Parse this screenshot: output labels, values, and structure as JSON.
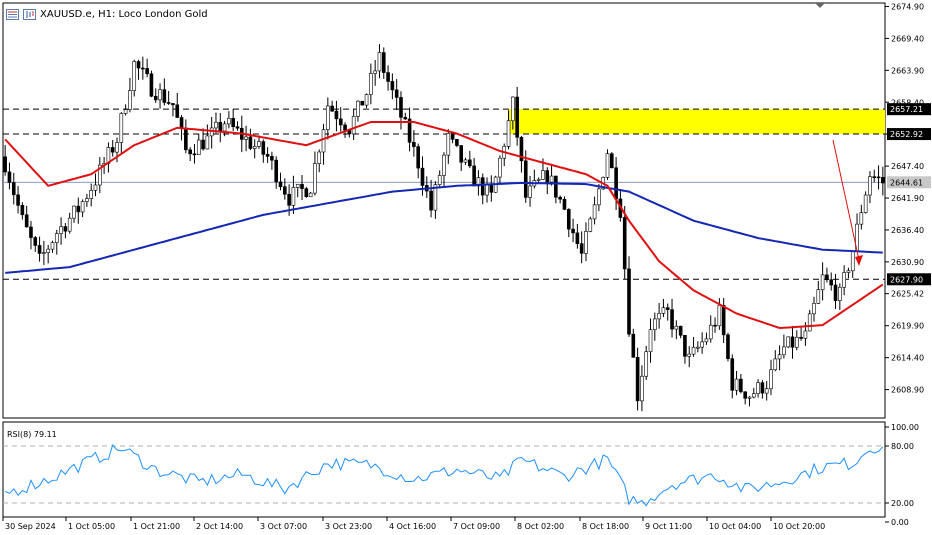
{
  "header": {
    "title": "XAUUSD.e, H1:  Loco London Gold"
  },
  "colors": {
    "background": "#ffffff",
    "candle": "#000000",
    "ma_fast": "#e01010",
    "ma_slow": "#1428b4",
    "zone": "#ffff00",
    "arrow": "#e01010",
    "rsi": "#1e90ff",
    "grid_dashed": "#000000"
  },
  "price_axis": {
    "ticks": [
      "2674.90",
      "2669.40",
      "2663.90",
      "2658.40",
      "2652.92",
      "2647.40",
      "2641.90",
      "2636.40",
      "2630.90",
      "2625.42",
      "2619.90",
      "2614.40",
      "2608.90"
    ],
    "tick_values": [
      2674.9,
      2669.4,
      2663.9,
      2658.4,
      2652.92,
      2647.4,
      2641.9,
      2636.4,
      2630.9,
      2625.42,
      2619.9,
      2614.4,
      2608.9
    ]
  },
  "price_labels": {
    "resistance_upper": "2657.21",
    "resistance_lower": "2652.92",
    "current": "2644.61",
    "support": "2627.90"
  },
  "time_axis": {
    "labels": [
      "30 Sep 2024",
      "1 Oct 05:00",
      "1 Oct 21:00",
      "2 Oct 14:00",
      "3 Oct 07:00",
      "3 Oct 23:00",
      "4 Oct 16:00",
      "7 Oct 09:00",
      "8 Oct 02:00",
      "8 Oct 18:00",
      "9 Oct 11:00",
      "10 Oct 04:00",
      "10 Oct 20:00"
    ]
  },
  "rsi": {
    "label": "RSI(8) 79.11",
    "ticks": [
      "100.00",
      "80.00",
      "20.00",
      "0.00"
    ],
    "tick_values": [
      100,
      80,
      20,
      0
    ]
  },
  "chart_data": {
    "type": "candlestick",
    "title": "XAUUSD.e, H1:  Loco London Gold",
    "ylim": [
      2604.0,
      2675.5
    ],
    "horizontal_levels": [
      2657.21,
      2652.92,
      2644.61,
      2627.9
    ],
    "zone": [
      2652.92,
      2657.21
    ],
    "anchors": [
      {
        "i": 0,
        "c": 2648
      },
      {
        "i": 4,
        "c": 2638
      },
      {
        "i": 8,
        "c": 2631
      },
      {
        "i": 12,
        "c": 2636
      },
      {
        "i": 17,
        "c": 2640
      },
      {
        "i": 21,
        "c": 2645
      },
      {
        "i": 26,
        "c": 2652
      },
      {
        "i": 30,
        "c": 2665
      },
      {
        "i": 34,
        "c": 2661
      },
      {
        "i": 39,
        "c": 2658
      },
      {
        "i": 42,
        "c": 2650
      },
      {
        "i": 47,
        "c": 2652
      },
      {
        "i": 51,
        "c": 2655
      },
      {
        "i": 56,
        "c": 2652
      },
      {
        "i": 61,
        "c": 2649
      },
      {
        "i": 66,
        "c": 2642
      },
      {
        "i": 71,
        "c": 2644
      },
      {
        "i": 75,
        "c": 2658
      },
      {
        "i": 80,
        "c": 2654
      },
      {
        "i": 84,
        "c": 2660
      },
      {
        "i": 87,
        "c": 2666
      },
      {
        "i": 92,
        "c": 2656
      },
      {
        "i": 96,
        "c": 2648
      },
      {
        "i": 99,
        "c": 2640
      },
      {
        "i": 103,
        "c": 2652
      },
      {
        "i": 108,
        "c": 2646
      },
      {
        "i": 113,
        "c": 2642
      },
      {
        "i": 118,
        "c": 2658
      },
      {
        "i": 121,
        "c": 2642
      },
      {
        "i": 126,
        "c": 2646
      },
      {
        "i": 130,
        "c": 2640
      },
      {
        "i": 134,
        "c": 2632
      },
      {
        "i": 137,
        "c": 2640
      },
      {
        "i": 140,
        "c": 2650
      },
      {
        "i": 143,
        "c": 2640
      },
      {
        "i": 145,
        "c": 2620
      },
      {
        "i": 147,
        "c": 2608
      },
      {
        "i": 150,
        "c": 2620
      },
      {
        "i": 154,
        "c": 2622
      },
      {
        "i": 159,
        "c": 2614
      },
      {
        "i": 163,
        "c": 2618
      },
      {
        "i": 166,
        "c": 2622
      },
      {
        "i": 169,
        "c": 2610
      },
      {
        "i": 173,
        "c": 2608
      },
      {
        "i": 177,
        "c": 2610
      },
      {
        "i": 181,
        "c": 2616
      },
      {
        "i": 186,
        "c": 2618
      },
      {
        "i": 190,
        "c": 2628
      },
      {
        "i": 194,
        "c": 2625
      },
      {
        "i": 197,
        "c": 2633
      },
      {
        "i": 199,
        "c": 2640
      },
      {
        "i": 201,
        "c": 2646
      },
      {
        "i": 204,
        "c": 2644.61
      }
    ],
    "ma_fast": [
      {
        "i": 0,
        "v": 2652
      },
      {
        "i": 10,
        "v": 2644
      },
      {
        "i": 20,
        "v": 2646
      },
      {
        "i": 30,
        "v": 2651
      },
      {
        "i": 40,
        "v": 2654
      },
      {
        "i": 55,
        "v": 2653
      },
      {
        "i": 70,
        "v": 2651
      },
      {
        "i": 85,
        "v": 2655
      },
      {
        "i": 95,
        "v": 2655
      },
      {
        "i": 105,
        "v": 2653
      },
      {
        "i": 115,
        "v": 2650
      },
      {
        "i": 125,
        "v": 2648
      },
      {
        "i": 135,
        "v": 2646
      },
      {
        "i": 140,
        "v": 2644
      },
      {
        "i": 145,
        "v": 2638
      },
      {
        "i": 152,
        "v": 2631
      },
      {
        "i": 160,
        "v": 2626
      },
      {
        "i": 170,
        "v": 2622
      },
      {
        "i": 180,
        "v": 2619.5
      },
      {
        "i": 190,
        "v": 2620
      },
      {
        "i": 198,
        "v": 2624
      },
      {
        "i": 204,
        "v": 2627
      }
    ],
    "ma_slow": [
      {
        "i": 0,
        "v": 2629
      },
      {
        "i": 15,
        "v": 2630
      },
      {
        "i": 30,
        "v": 2633
      },
      {
        "i": 45,
        "v": 2636
      },
      {
        "i": 60,
        "v": 2639
      },
      {
        "i": 75,
        "v": 2641
      },
      {
        "i": 90,
        "v": 2643
      },
      {
        "i": 105,
        "v": 2644
      },
      {
        "i": 120,
        "v": 2644.5
      },
      {
        "i": 135,
        "v": 2644.3
      },
      {
        "i": 145,
        "v": 2643
      },
      {
        "i": 160,
        "v": 2638
      },
      {
        "i": 175,
        "v": 2635
      },
      {
        "i": 190,
        "v": 2633
      },
      {
        "i": 204,
        "v": 2632.5
      }
    ],
    "rsi_anchors": [
      {
        "i": 0,
        "v": 30
      },
      {
        "i": 10,
        "v": 45
      },
      {
        "i": 20,
        "v": 65
      },
      {
        "i": 27,
        "v": 78
      },
      {
        "i": 35,
        "v": 55
      },
      {
        "i": 45,
        "v": 42
      },
      {
        "i": 55,
        "v": 50
      },
      {
        "i": 65,
        "v": 35
      },
      {
        "i": 75,
        "v": 62
      },
      {
        "i": 85,
        "v": 60
      },
      {
        "i": 95,
        "v": 45
      },
      {
        "i": 105,
        "v": 55
      },
      {
        "i": 115,
        "v": 45
      },
      {
        "i": 120,
        "v": 65
      },
      {
        "i": 130,
        "v": 48
      },
      {
        "i": 140,
        "v": 66
      },
      {
        "i": 145,
        "v": 25
      },
      {
        "i": 148,
        "v": 20
      },
      {
        "i": 155,
        "v": 40
      },
      {
        "i": 165,
        "v": 50
      },
      {
        "i": 172,
        "v": 34
      },
      {
        "i": 180,
        "v": 42
      },
      {
        "i": 190,
        "v": 58
      },
      {
        "i": 197,
        "v": 62
      },
      {
        "i": 201,
        "v": 79
      },
      {
        "i": 204,
        "v": 79.11
      }
    ]
  }
}
